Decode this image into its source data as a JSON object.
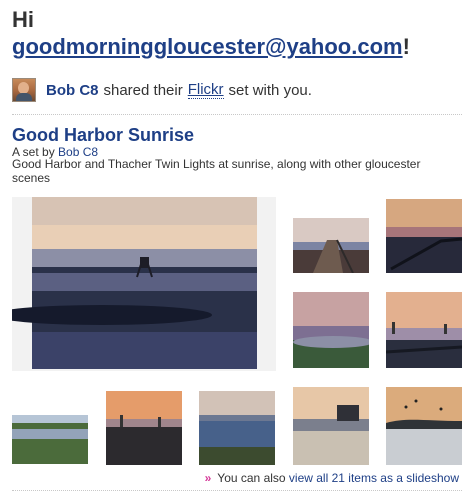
{
  "header": {
    "greeting": "Hi",
    "email": "goodmorninggloucester@yahoo.com",
    "exclaim": "!"
  },
  "share": {
    "avatar": "user-avatar-photo",
    "sharer": "Bob C8",
    "before_link": "shared their",
    "link": "Flickr",
    "after_link": "set with you."
  },
  "set": {
    "title": "Good Harbor Sunrise",
    "by_prefix": "A set by",
    "by_name": "Bob C8",
    "description": "Good Harbor and Thacher Twin Lights at sunrise, along with other gloucester scenes"
  },
  "photos": [
    {
      "id": "photo-lifeguard-chair-sunrise"
    },
    {
      "id": "photo-boardwalk-pier"
    },
    {
      "id": "photo-footbridge-dusk"
    },
    {
      "id": "photo-pink-sky-shore"
    },
    {
      "id": "photo-twin-lights-dusk"
    },
    {
      "id": "photo-beach-sunrise-chair"
    },
    {
      "id": "photo-marsh-grass-shore"
    },
    {
      "id": "photo-twin-lights-orange-sky"
    },
    {
      "id": "photo-harbor-water-blue"
    },
    {
      "id": "photo-mansion-on-point"
    },
    {
      "id": "photo-birds-over-water"
    }
  ],
  "footer": {
    "arrow": "»",
    "prefix": "You can also",
    "link": "view all 21 items as a slideshow"
  },
  "colors": {
    "link": "#1e3f86",
    "accent": "#d63a9a"
  }
}
